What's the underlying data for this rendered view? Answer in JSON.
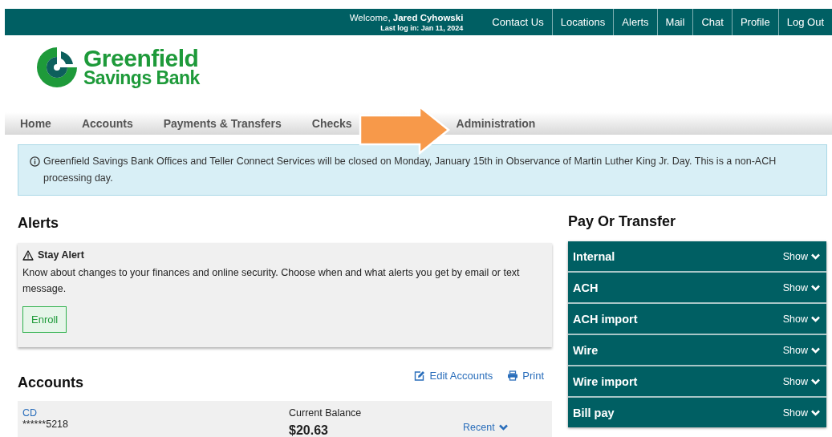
{
  "top_bar": {
    "welcome": "Welcome, **Jared Cyhowski**",
    "last_login": "Last log in: Jan 11, 2024",
    "links": [
      {
        "label": "Contact Us"
      },
      {
        "label": "Locations"
      },
      {
        "label": "Alerts"
      },
      {
        "label": "Mail"
      },
      {
        "label": "Chat"
      },
      {
        "label": "Profile"
      },
      {
        "label": "Log Out"
      }
    ]
  },
  "logo": {
    "line_1": "Greenfield",
    "line_2": "Savings Bank"
  },
  "nav": [
    {
      "label": "Home"
    },
    {
      "label": "Accounts"
    },
    {
      "label": "Payments & Transfers"
    },
    {
      "label": "Checks"
    },
    {
      "label": "Administration"
    }
  ],
  "notice": "Greenfield Savings Bank Offices and Teller Connect Services will be closed on Monday, January 15th in Observance of Martin Luther King Jr. Day. This is a non-ACH processing day.",
  "alerts": {
    "title": "Alerts",
    "card_title": "Stay Alert",
    "text": "Know about changes to your finances and online security. Choose when and what alerts you get by email or text message.",
    "button": "Enroll"
  },
  "accounts": {
    "title": "Accounts",
    "edit": "Edit Accounts",
    "print": "Print",
    "rows": [
      {
        "name": "CD",
        "number": "******5218",
        "balance_label": "Current Balance",
        "balance": "$20.63",
        "recent": "Recent"
      }
    ]
  },
  "pay_or_transfer": {
    "title": "Pay Or Transfer",
    "items": [
      {
        "label": "Internal",
        "action": "Show"
      },
      {
        "label": "ACH",
        "action": "Show"
      },
      {
        "label": "ACH import",
        "action": "Show"
      },
      {
        "label": "Wire",
        "action": "Show"
      },
      {
        "label": "Wire import",
        "action": "Show"
      },
      {
        "label": "Bill pay",
        "action": "Show"
      }
    ]
  }
}
